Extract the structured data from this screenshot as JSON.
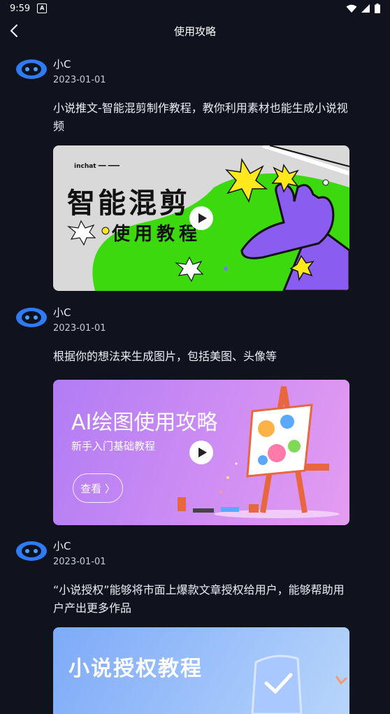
{
  "status": {
    "time": "9:59",
    "notif": "A"
  },
  "header": {
    "title": "使用攻略"
  },
  "posts": [
    {
      "author": "小C",
      "date": "2023-01-01",
      "desc": "小说推文-智能混剪制作教程，教你利用素材也能生成小说视频",
      "banner": {
        "title": "智能混剪",
        "subtitle": "使用教程",
        "brand": "inchat ━━ ━━━"
      }
    },
    {
      "author": "小C",
      "date": "2023-01-01",
      "desc": "根据你的想法来生成图片，包括美图、头像等",
      "banner": {
        "title": "AI绘图使用攻略",
        "subtitle": "新手入门基础教程",
        "button": "查看 〉"
      }
    },
    {
      "author": "小C",
      "date": "2023-01-01",
      "desc": "“小说授权”能够将市面上爆款文章授权给用户，能够帮助用户产出更多作品",
      "banner": {
        "title": "小说授权教程"
      }
    }
  ],
  "colors": {
    "background": "#10131e",
    "avatar": "#2f7bf5",
    "banner1_green": "#3dd90f",
    "banner1_purple": "#8a5cf0",
    "banner2_from": "#b27cf4",
    "banner2_to": "#e59cf2",
    "banner3_from": "#7eaaf8",
    "banner3_to": "#b7d5fb"
  },
  "icons": {
    "back": "chevron-left-icon",
    "play": "play-icon",
    "avatar": "robot-icon"
  }
}
